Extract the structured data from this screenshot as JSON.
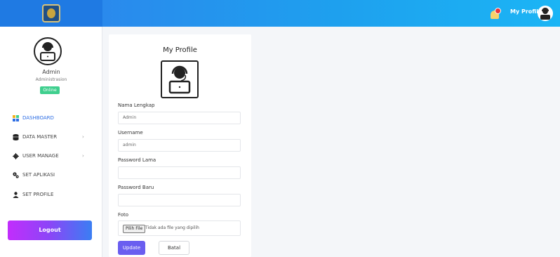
{
  "topbar": {
    "profile_label": "My Profile",
    "notification_icon": "bell-icon",
    "avatar_icon": "user-headset-icon"
  },
  "sidebar": {
    "user_name": "Admin",
    "user_role": "Administrasion",
    "status": "Online",
    "items": [
      {
        "label": "DASHBOARD",
        "icon": "dashboard-icon"
      },
      {
        "label": "DATA MASTER",
        "icon": "database-icon"
      },
      {
        "label": "USER MANAGE",
        "icon": "gear-icon"
      },
      {
        "label": "SET APLIKASI",
        "icon": "gears-icon"
      },
      {
        "label": "SET PROFILE",
        "icon": "user-icon"
      }
    ],
    "logout_label": "Logout"
  },
  "profile_form": {
    "title": "My Profile",
    "fields": {
      "nama_label": "Nama Lengkap",
      "nama_value": "Admin",
      "username_label": "Username",
      "username_value": "admin",
      "password_lama_label": "Password Lama",
      "password_baru_label": "Password Baru",
      "foto_label": "Foto",
      "file_button": "Pilih File",
      "file_status": "Tidak ada file yang dipilih"
    },
    "update_label": "Update",
    "cancel_label": "Batal"
  },
  "colors": {
    "topbar_start": "#2f80ec",
    "topbar_end": "#1bb5f5",
    "active_menu": "#2f6fe4",
    "online_badge": "#3fcf8e",
    "update_button": "#6a5ef0"
  }
}
